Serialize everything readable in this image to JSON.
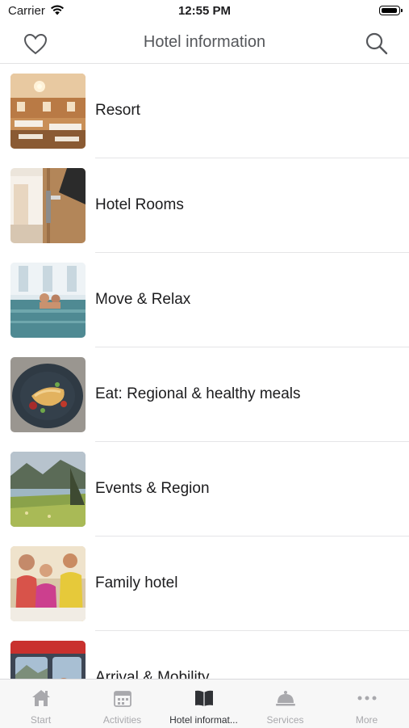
{
  "status_bar": {
    "carrier": "Carrier",
    "time": "12:55 PM"
  },
  "nav": {
    "title": "Hotel information",
    "left_icon": "heart-icon",
    "right_icon": "search-icon"
  },
  "items": [
    {
      "label": "Resort",
      "thumb": "restaurant-interior"
    },
    {
      "label": "Hotel Rooms",
      "thumb": "hotel-room-door"
    },
    {
      "label": "Move & Relax",
      "thumb": "indoor-pool"
    },
    {
      "label": "Eat: Regional & healthy meals",
      "thumb": "plated-fish-dish"
    },
    {
      "label": "Events & Region",
      "thumb": "alpine-lake-landscape"
    },
    {
      "label": "Family hotel",
      "thumb": "family-at-table"
    },
    {
      "label": "Arrival & Mobility",
      "thumb": "train-window"
    }
  ],
  "tab_bar": {
    "tabs": [
      {
        "label": "Start",
        "icon": "home-icon",
        "active": false
      },
      {
        "label": "Activities",
        "icon": "calendar-icon",
        "active": false
      },
      {
        "label": "Hotel informat...",
        "icon": "book-icon",
        "active": true
      },
      {
        "label": "Services",
        "icon": "service-bell-icon",
        "active": false
      },
      {
        "label": "More",
        "icon": "more-dots-icon",
        "active": false
      }
    ]
  },
  "colors": {
    "active_tab": "#303236",
    "inactive_tab": "#a9a9ad",
    "title": "#55575b"
  }
}
